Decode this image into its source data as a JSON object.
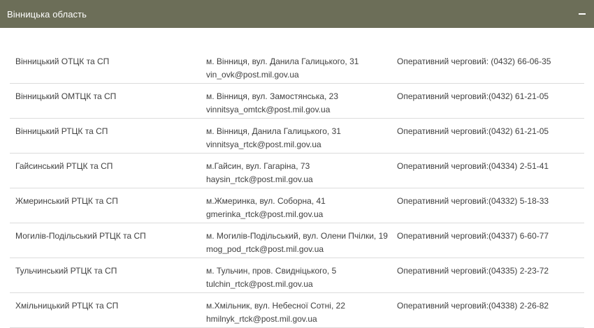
{
  "region": {
    "title": "Вінницька область"
  },
  "offices": [
    {
      "name": "Вінницький ОТЦК та СП",
      "address": "м. Вінниця, вул. Данила Галицького, 31",
      "email": "vin_ovk@post.mil.gov.ua",
      "phone": "Оперативний черговий: (0432) 66-06-35"
    },
    {
      "name": "Вінницький ОМТЦК та СП",
      "address": "м. Вінниця, вул. Замостянська, 23",
      "email": "vinnitsya_omtck@post.mil.gov.ua",
      "phone": "Оперативний черговий:(0432) 61-21-05"
    },
    {
      "name": "Вінницький РТЦК та СП",
      "address": "м. Вінниця, Данила Галицького, 31",
      "email": "vinnitsya_rtck@post.mil.gov.ua",
      "phone": "Оперативний черговий:(0432) 61-21-05"
    },
    {
      "name": "Гайсинський РТЦК та СП",
      "address": "м.Гайсин, вул. Гагаріна, 73",
      "email": "haysin_rtck@post.mil.gov.ua",
      "phone": "Оперативний черговий:(04334) 2-51-41"
    },
    {
      "name": "Жмеринський РТЦК та СП",
      "address": "м.Жмеринка, вул. Соборна, 41",
      "email": "gmerinka_rtck@post.mil.gov.ua",
      "phone": "Оперативний черговий:(04332) 5-18-33"
    },
    {
      "name": "Могилів-Подільський РТЦК та СП",
      "address": "м. Могилів-Подільський, вул. Олени Пчілки, 19",
      "email": "mog_pod_rtck@post.mil.gov.ua",
      "phone": "Оперативний черговий:(04337) 6-60-77"
    },
    {
      "name": "Тульчинський РТЦК та СП",
      "address": "м. Тульчин, пров. Свидніцького, 5",
      "email": "tulchin_rtck@post.mil.gov.ua",
      "phone": "Оперативний черговий:(04335) 2-23-72"
    },
    {
      "name": "Хмільницький РТЦК та СП",
      "address": "м.Хмільник, вул. Небесної Сотні, 22",
      "email": "hmilnyk_rtck@post.mil.gov.ua",
      "phone": "Оперативний черговий:(04338) 2-26-82"
    }
  ]
}
